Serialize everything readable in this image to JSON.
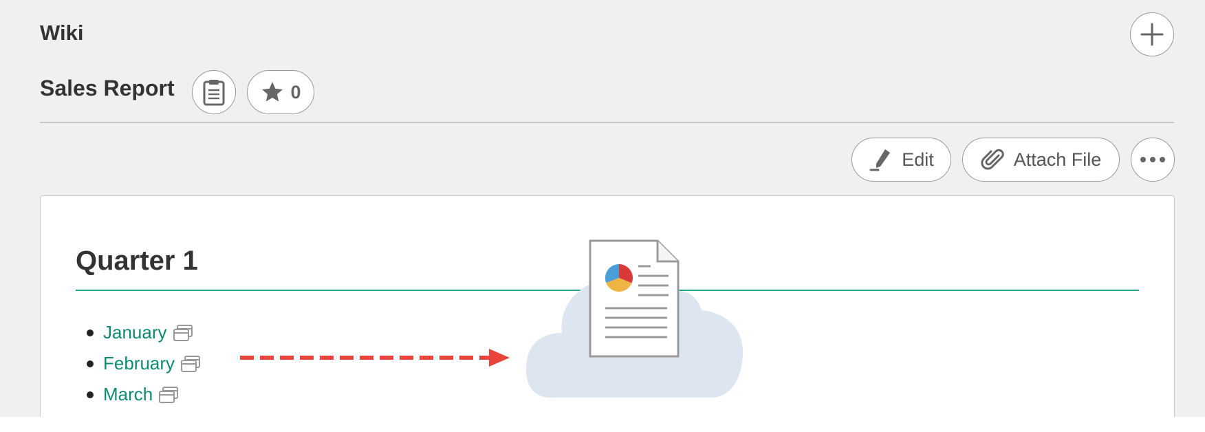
{
  "header": {
    "section_title": "Wiki",
    "add_icon": "plus-icon"
  },
  "page": {
    "title": "Sales Report",
    "clipboard_icon": "clipboard-icon",
    "star_icon": "star-icon",
    "star_count": "0"
  },
  "toolbar": {
    "edit_label": "Edit",
    "edit_icon": "pen-icon",
    "attach_label": "Attach File",
    "attach_icon": "paperclip-icon",
    "more_icon": "ellipsis-icon"
  },
  "content": {
    "heading": "Quarter 1",
    "links": [
      {
        "label": "January",
        "icon": "open-window-icon"
      },
      {
        "label": "February",
        "icon": "open-window-icon"
      },
      {
        "label": "March",
        "icon": "open-window-icon"
      }
    ]
  },
  "colors": {
    "background": "#f0f0f0",
    "accent_teal": "#21a48a",
    "link": "#0d8a74",
    "arrow": "#e8453c",
    "cloud": "#dde6f0",
    "pie_blue": "#4a9fd8",
    "pie_red": "#d83a3a",
    "pie_yellow": "#f0b444"
  },
  "illustration": {
    "cloud_icon": "cloud-icon",
    "document_icon": "report-document-icon",
    "arrow_icon": "dashed-arrow-icon"
  }
}
